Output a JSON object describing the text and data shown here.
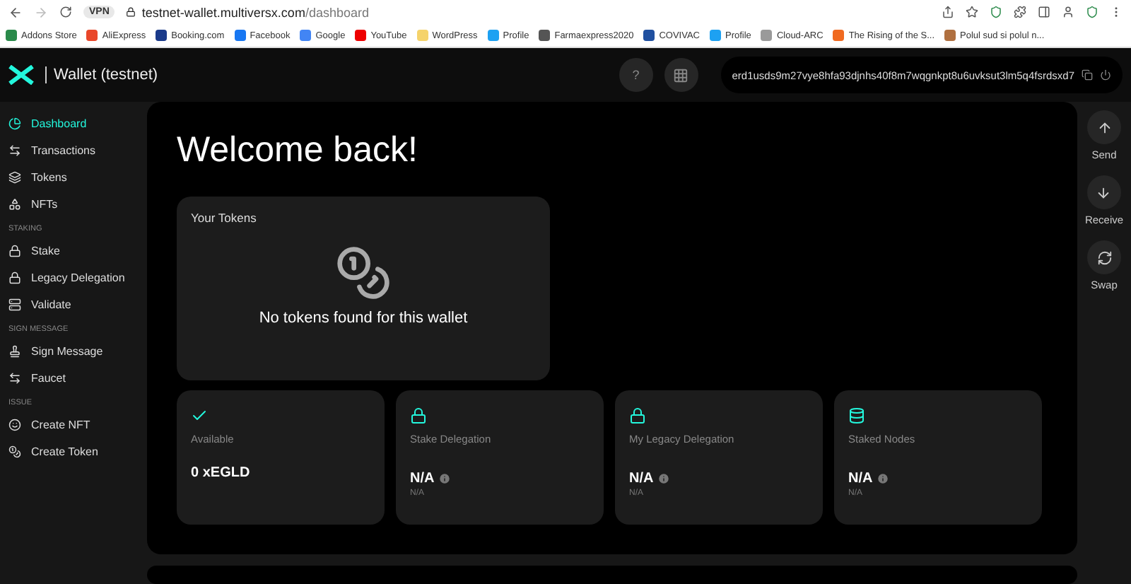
{
  "browser": {
    "url_host": "testnet-wallet.multiversx.com",
    "url_path": "/dashboard",
    "vpn": "VPN",
    "bookmarks": [
      "Addons Store",
      "AliExpress",
      "Booking.com",
      "Facebook",
      "Google",
      "YouTube",
      "WordPress",
      "Profile",
      "Farmaexpress2020",
      "COVIVAC",
      "Profile",
      "Cloud-ARC",
      "The Rising of the S...",
      "Polul sud si polul n..."
    ]
  },
  "header": {
    "brand": "Wallet (testnet)",
    "help": "?",
    "address": "erd1usds9m27vye8hfa93djnhs40f8m7wqgnkpt8u6uvksut3lm5q4fsrdsxd7"
  },
  "sidebar": [
    {
      "items": [
        {
          "label": "Dashboard",
          "selected": true
        },
        {
          "label": "Transactions",
          "selected": false
        },
        {
          "label": "Tokens",
          "selected": false
        },
        {
          "label": "NFTs",
          "selected": false
        }
      ]
    },
    {
      "heading": "STAKING",
      "items": [
        {
          "label": "Stake",
          "selected": false
        },
        {
          "label": "Legacy Delegation",
          "selected": false
        },
        {
          "label": "Validate",
          "selected": false
        }
      ]
    },
    {
      "heading": "SIGN MESSAGE",
      "items": [
        {
          "label": "Sign Message",
          "selected": false
        },
        {
          "label": "Faucet",
          "selected": false
        }
      ]
    },
    {
      "heading": "ISSUE",
      "items": [
        {
          "label": "Create NFT",
          "selected": false
        },
        {
          "label": "Create Token",
          "selected": false
        }
      ]
    }
  ],
  "main": {
    "title": "Welcome back!",
    "tokens_card": {
      "title": "Your Tokens",
      "empty_text": "No tokens found for this wallet"
    },
    "stats": [
      {
        "kind": "balance",
        "label": "Available",
        "value": "0 xEGLD"
      },
      {
        "kind": "pending",
        "label": "Stake Delegation",
        "value": "N/A",
        "sub": "N/A"
      },
      {
        "kind": "pending",
        "label": "My Legacy Delegation",
        "value": "N/A",
        "sub": "N/A"
      },
      {
        "kind": "pending",
        "label": "Staked Nodes",
        "value": "N/A",
        "sub": "N/A"
      }
    ]
  },
  "actions": [
    {
      "label": "Send"
    },
    {
      "label": "Receive"
    },
    {
      "label": "Swap"
    }
  ]
}
